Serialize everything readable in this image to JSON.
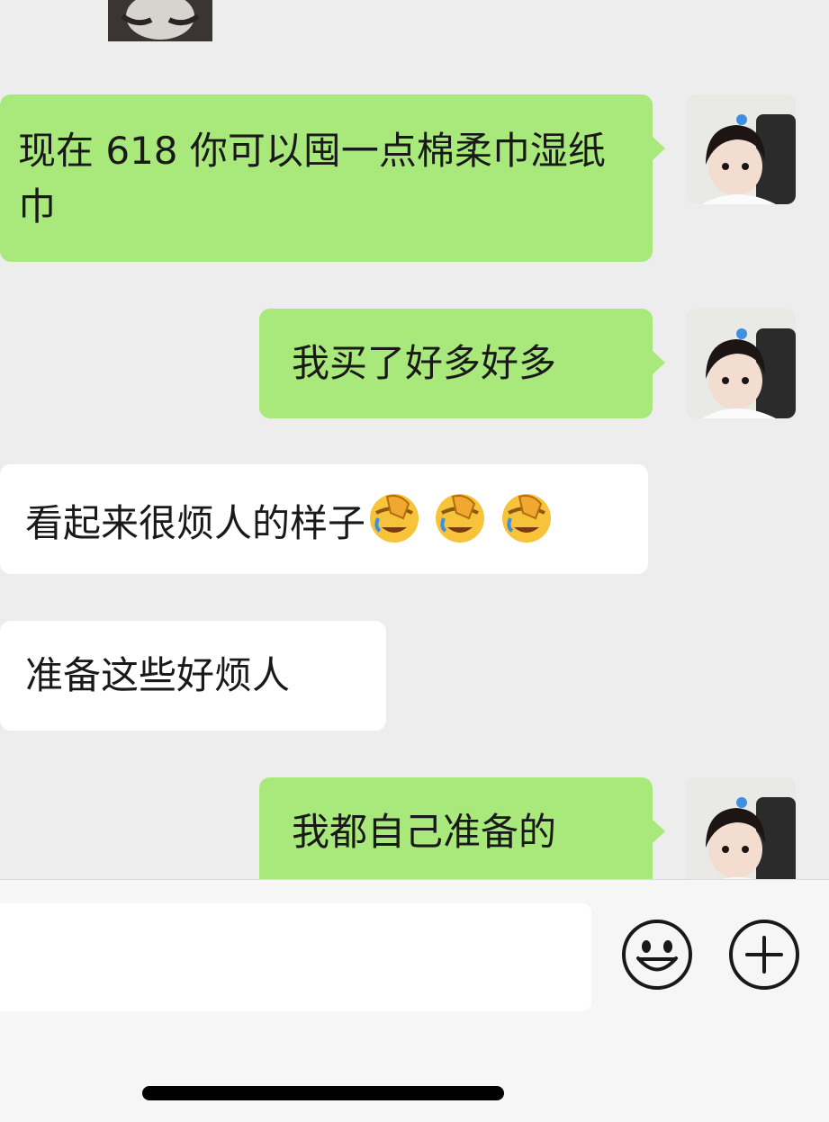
{
  "messages": [
    {
      "side": "right",
      "text": "现在 618 你可以囤一点棉柔巾湿纸巾"
    },
    {
      "side": "right",
      "text": "我买了好多好多"
    },
    {
      "side": "left",
      "text": "看起来很烦人的样子",
      "emoji": [
        "face-palm-laughing-icon",
        "face-palm-laughing-icon",
        "face-palm-laughing-icon"
      ]
    },
    {
      "side": "left",
      "text": "准备这些好烦人"
    },
    {
      "side": "right",
      "text": "我都自己准备的"
    }
  ],
  "input": {
    "value": "",
    "placeholder": ""
  },
  "icons": {
    "emoji": "smiley-icon",
    "more": "plus-circle-icon"
  },
  "colors": {
    "outgoing_bubble": "#a9e97b",
    "incoming_bubble": "#ffffff",
    "background": "#ededed"
  }
}
